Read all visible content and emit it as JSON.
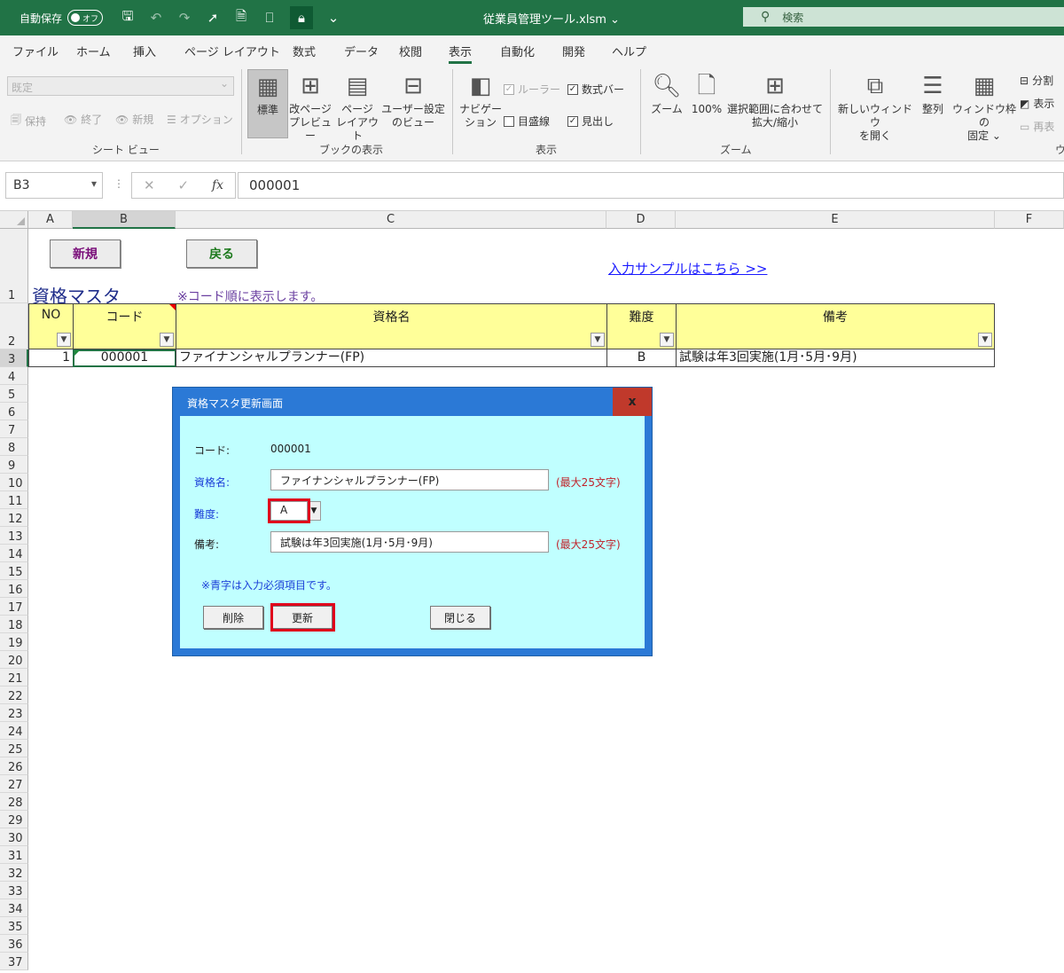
{
  "titlebar": {
    "autosave_label": "自動保存",
    "toggle_label": "オフ",
    "filename": "従業員管理ツール.xlsm ⌄",
    "search_placeholder": "検索"
  },
  "tabs": [
    "ファイル",
    "ホーム",
    "挿入",
    "ページ レイアウト",
    "数式",
    "データ",
    "校閲",
    "表示",
    "自動化",
    "開発",
    "ヘルプ"
  ],
  "active_tab": "表示",
  "ribbon": {
    "sheetview": {
      "dropdown": "既定",
      "keep": "保持",
      "exit": "終了",
      "new": "新規",
      "options": "オプション",
      "label": "シート ビュー"
    },
    "bookview": {
      "normal": "標準",
      "pagebreak_1": "改ページ",
      "pagebreak_2": "プレビュー",
      "pagelayout_1": "ページ",
      "pagelayout_2": "レイアウト",
      "custom_1": "ユーザー設定",
      "custom_2": "のビュー",
      "label": "ブックの表示"
    },
    "show": {
      "nav_1": "ナビゲー",
      "nav_2": "ション",
      "ruler": "ルーラー",
      "formulabar": "数式バー",
      "gridlines": "目盛線",
      "headings": "見出し",
      "label": "表示"
    },
    "zoom": {
      "zoom": "ズーム",
      "hundred": "100%",
      "sel_1": "選択範囲に合わせて",
      "sel_2": "拡大/縮小",
      "label": "ズーム"
    },
    "window": {
      "new_1": "新しいウィンドウ",
      "new_2": "を開く",
      "arrange": "整列",
      "freeze_1": "ウィンドウ枠の",
      "freeze_2": "固定 ⌄",
      "split": "分割",
      "hide": "表示",
      "unhide": "再表",
      "label": "ウ"
    }
  },
  "formula_bar": {
    "namebox": "B3",
    "fx": "fx",
    "value": "000001"
  },
  "columns": [
    "A",
    "B",
    "C",
    "D",
    "E",
    "F"
  ],
  "rows": [
    "1",
    "2",
    "3",
    "4",
    "5",
    "6",
    "7",
    "8",
    "9",
    "10",
    "11",
    "12",
    "13",
    "14",
    "15",
    "16",
    "17",
    "18",
    "19",
    "20",
    "21",
    "22",
    "23",
    "24",
    "25",
    "26",
    "27",
    "28",
    "29",
    "30",
    "31",
    "32",
    "33",
    "34",
    "35",
    "36",
    "37"
  ],
  "sheet": {
    "btn_new": "新規",
    "btn_back": "戻る",
    "sample_link": "入力サンプルはこちら >>",
    "title": "資格マスタ",
    "note": "※コード順に表示します。",
    "headers": [
      "NO",
      "コード",
      "資格名",
      "難度",
      "備考"
    ],
    "row": {
      "no": "1",
      "code": "000001",
      "name": "ファイナンシャルプランナー(FP)",
      "level": "B",
      "remark": "試験は年3回実施(1月･5月･9月)"
    }
  },
  "dialog": {
    "title": "資格マスタ更新画面",
    "close": "x",
    "code_label": "コード:",
    "code_value": "000001",
    "name_label": "資格名:",
    "name_value": "ファイナンシャルプランナー(FP)",
    "name_hint": "(最大25文字)",
    "level_label": "難度:",
    "level_value": "A",
    "remark_label": "備考:",
    "remark_value": "試験は年3回実施(1月･5月･9月)",
    "remark_hint": "(最大25文字)",
    "required_note": "※青字は入力必須項目です。",
    "btn_delete": "削除",
    "btn_update": "更新",
    "btn_close": "閉じる"
  },
  "colors": {
    "excel_green": "#217346",
    "dialog_blue": "#2b79d6",
    "dialog_body": "#c0ffff",
    "header_yellow": "#ffff99",
    "highlight_red": "#e0001b"
  }
}
